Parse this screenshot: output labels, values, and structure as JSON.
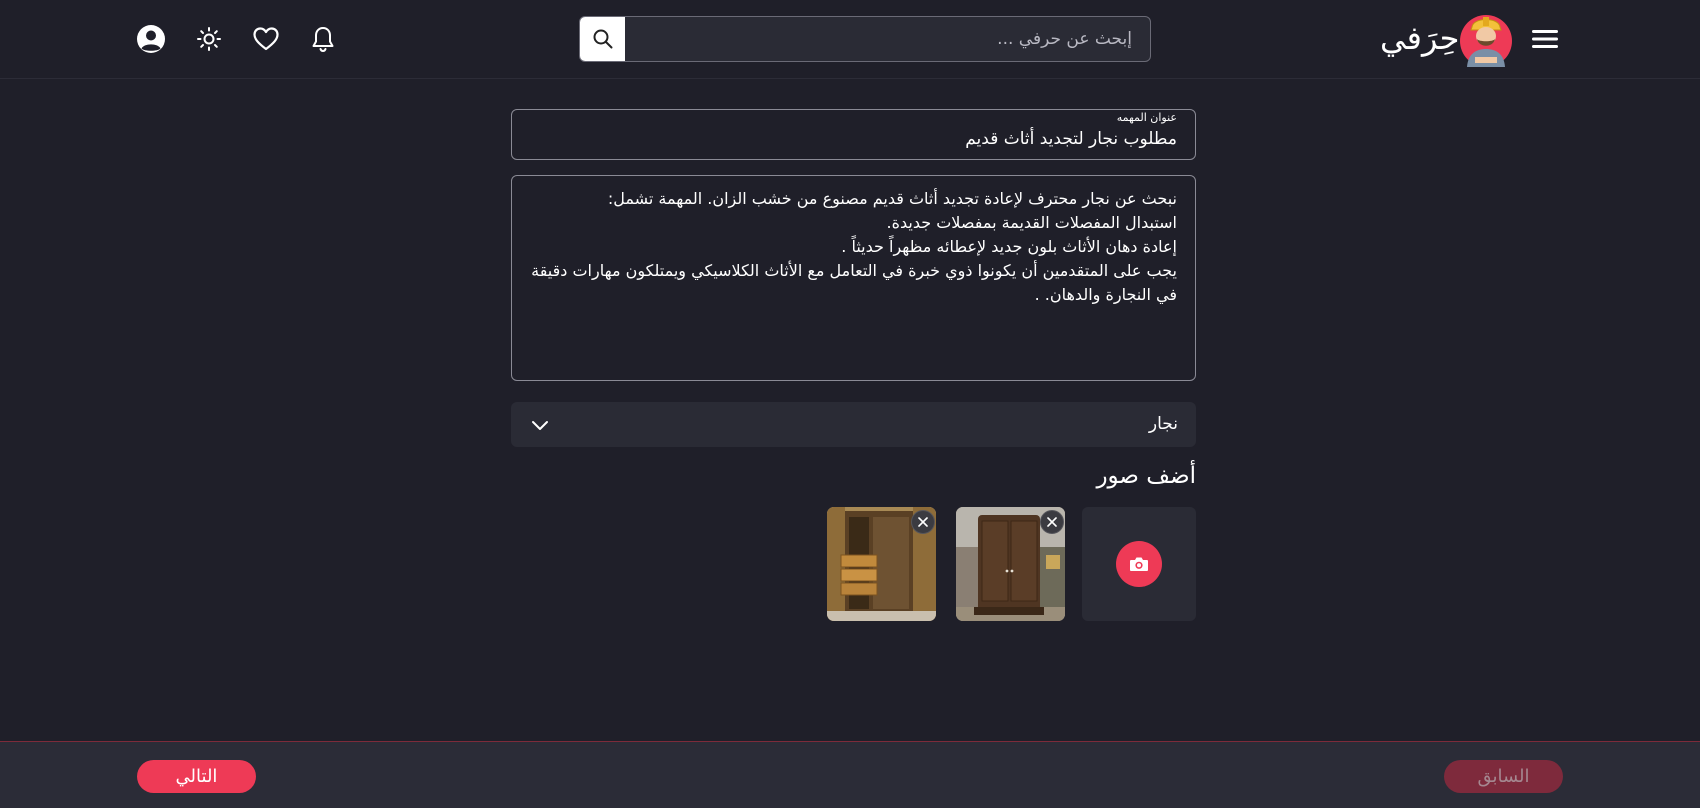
{
  "header": {
    "brand_name": "حِرَفي",
    "search_placeholder": "إبحث عن حرفي ..."
  },
  "form": {
    "title_label": "عنوان المهمه",
    "title_value": "مطلوب نجار لتجديد أثاث قديم",
    "description_lines": [
      "نبحث عن نجار محترف لإعادة تجديد أثاث قديم مصنوع من خشب الزان. المهمة تشمل:",
      "استبدال المفصلات القديمة بمفصلات جديدة.",
      "إعادة دهان الأثاث بلون جديد لإعطائه مظهراً حديثاً .",
      "يجب على المتقدمين أن يكونوا ذوي خبرة في التعامل مع الأثاث الكلاسيكي ويمتلكون مهارات دقيقة",
      "في النجارة والدهان. ."
    ],
    "category_value": "نجار",
    "photos_title": "أضف صور"
  },
  "footer": {
    "next_label": "التالي",
    "prev_label": "السابق"
  },
  "colors": {
    "accent": "#ee3a56",
    "background": "#1f1f29",
    "panel": "#2a2b35"
  }
}
